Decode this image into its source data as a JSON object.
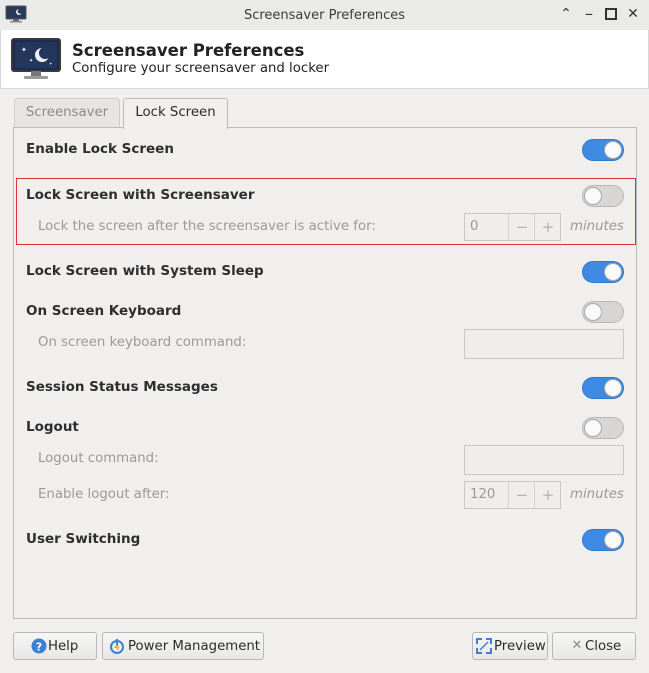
{
  "window": {
    "title": "Screensaver Preferences"
  },
  "header": {
    "title": "Screensaver Preferences",
    "subtitle": "Configure your screensaver and locker"
  },
  "tabs": [
    {
      "label": "Screensaver",
      "active": false
    },
    {
      "label": "Lock Screen",
      "active": true
    }
  ],
  "settings": {
    "enable_lock": {
      "label": "Enable Lock Screen",
      "on": true
    },
    "lock_with_saver": {
      "label": "Lock Screen with Screensaver",
      "on": false,
      "sub_label": "Lock the screen after the screensaver is active for:",
      "value": "0",
      "unit": "minutes"
    },
    "lock_with_sleep": {
      "label": "Lock Screen with System Sleep",
      "on": true
    },
    "osk": {
      "label": "On Screen Keyboard",
      "on": false,
      "sub_label": "On screen keyboard command:",
      "command_value": ""
    },
    "status_messages": {
      "label": "Session Status Messages",
      "on": true
    },
    "logout": {
      "label": "Logout",
      "on": false,
      "command_label": "Logout command:",
      "command_value": "",
      "after_label": "Enable logout after:",
      "after_value": "120",
      "unit": "minutes"
    },
    "user_switching": {
      "label": "User Switching",
      "on": true
    }
  },
  "buttons": {
    "help": "Help",
    "power": "Power Management",
    "preview": "Preview",
    "close": "Close"
  },
  "colors": {
    "accent": "#3f8ae2",
    "highlight_border": "#e0303a"
  }
}
